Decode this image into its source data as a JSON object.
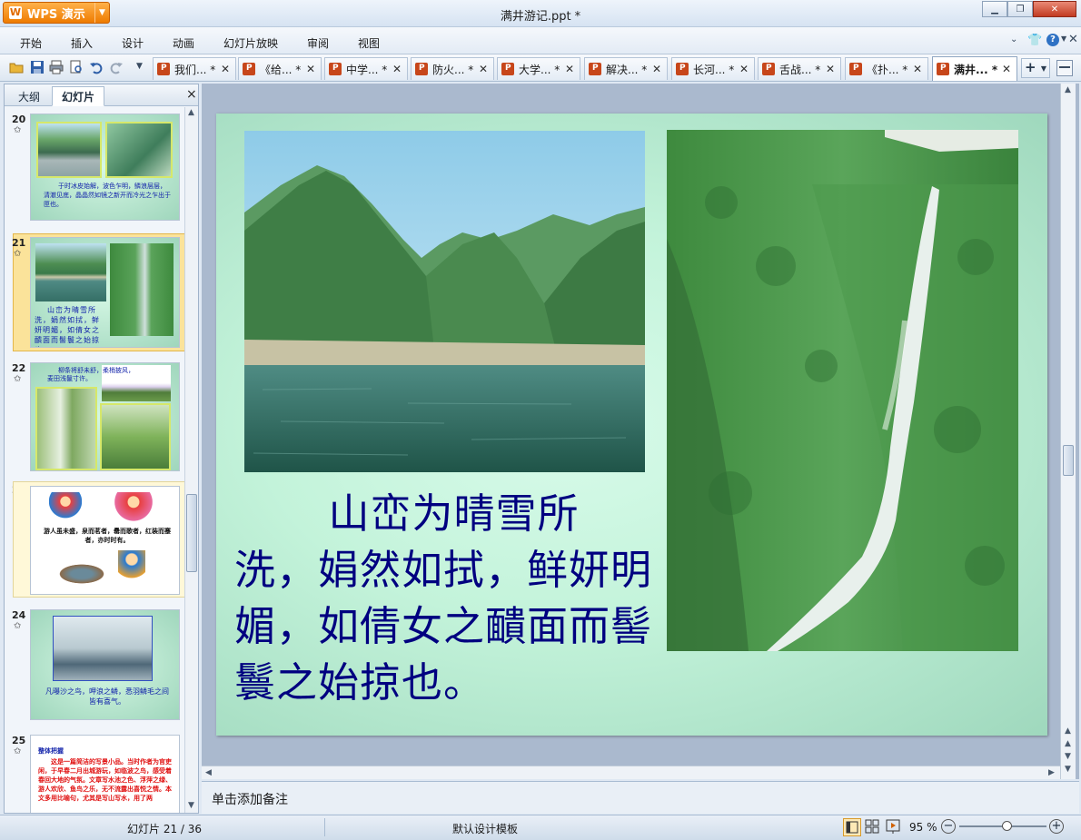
{
  "app": {
    "name": "WPS 演示",
    "logo": "W"
  },
  "window": {
    "title": "满井游记.ppt *"
  },
  "menu": [
    "开始",
    "插入",
    "设计",
    "动画",
    "幻灯片放映",
    "审阅",
    "视图"
  ],
  "doc_tabs": [
    "我们... *",
    "《给... *",
    "中学... *",
    "防火... *",
    "大学... *",
    "解决... *",
    "长河... *",
    "舌战... *",
    "《扑... *",
    "满井... *"
  ],
  "active_tab_index": 9,
  "panel": {
    "tab_outline": "大纲",
    "tab_slides": "幻灯片",
    "close": "×"
  },
  "thumbnails": [
    {
      "num": "20",
      "text": "于时冰皮始解，波色乍明，鳞浪层层，清澈见底，晶晶然如镜之新开而冷光之乍出于匣也。"
    },
    {
      "num": "21",
      "text": "山峦为晴雪所洗，娟然如拭，鲜妍明媚，如倩女之靧面而髻鬟之始掠也。"
    },
    {
      "num": "22",
      "text": "柳条将舒未舒，柔梢披风，麦田浅鬣寸许。"
    },
    {
      "num": "23",
      "text": "游人虽未盛，泉而茗者，罍而歌者，红装而蹇者，亦时时有。"
    },
    {
      "num": "24",
      "text": "凡曝沙之鸟，呷浪之鳞，悉羽鳞毛之间皆有喜气。"
    },
    {
      "num": "25",
      "heading": "整体把握",
      "text": "这是一篇简洁的写景小品。当时作者为官吏闲，于早春二月出城游玩，如临波之鸟，感受着春回大地的气氛。文章写水池之色、浮萍之绿、游人欢欣、鱼鸟之乐，无不流露出喜悦之情。本文多用比喻句，尤其是写山写水，用了两"
    }
  ],
  "slide": {
    "text": "山峦为晴雪所洗，娟然如拭，鲜妍明媚，如倩女之靧面而髻鬟之始掠也。"
  },
  "notes": {
    "placeholder": "单击添加备注"
  },
  "status": {
    "slide_pos": "幻灯片 21 / 36",
    "template": "默认设计模板",
    "zoom": "95 %"
  },
  "zoom_level": 0.55,
  "colors": {
    "accent": "#f08300",
    "slide_text": "#000080",
    "selection": "#fbe39a"
  }
}
